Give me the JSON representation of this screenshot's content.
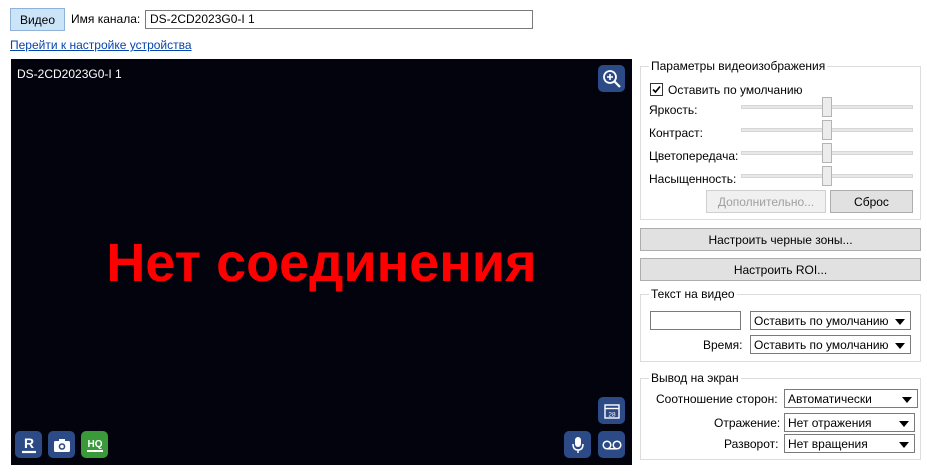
{
  "header": {
    "video_tab": "Видео",
    "channel_label": "Имя канала:",
    "channel_value": "DS-2CD2023G0-I 1",
    "device_link": "Перейти к настройке устройства"
  },
  "video": {
    "overlay_title": "DS-2CD2023G0-I 1",
    "no_connection": "Нет соединения",
    "calendar_day": "28",
    "icons": {
      "zoom": "zoom-in-icon",
      "record": "record-r-icon",
      "snapshot": "camera-icon",
      "quality": "HQ",
      "calendar": "calendar-icon",
      "mic": "microphone-icon",
      "voicemail": "voicemail-icon"
    },
    "colors": {
      "background": "#03030e",
      "message": "#ff0000",
      "icon_bg": "#2b4a86",
      "hq_bg": "#3a9a3a"
    }
  },
  "image_params": {
    "title": "Параметры видеоизображения",
    "default_checkbox": "Оставить по умолчанию",
    "default_checked": true,
    "sliders": [
      {
        "label": "Яркость:",
        "value": 0.5
      },
      {
        "label": "Контраст:",
        "value": 0.5
      },
      {
        "label": "Цветопередача:",
        "value": 0.5
      },
      {
        "label": "Насыщенность:",
        "value": 0.5
      }
    ],
    "advanced_button": "Дополнительно...",
    "reset_button": "Сброс"
  },
  "buttons": {
    "black_zones": "Настроить черные зоны...",
    "roi": "Настроить ROI..."
  },
  "text_on_video": {
    "title": "Текст на видео",
    "text_value": "",
    "text_option": "Оставить по умолчанию",
    "time_label": "Время:",
    "time_option": "Оставить по умолчанию"
  },
  "display_output": {
    "title": "Вывод на экран",
    "aspect_label": "Соотношение сторон:",
    "aspect_value": "Автоматически",
    "mirror_label": "Отражение:",
    "mirror_value": "Нет отражения",
    "rotate_label": "Разворот:",
    "rotate_value": "Нет вращения"
  }
}
